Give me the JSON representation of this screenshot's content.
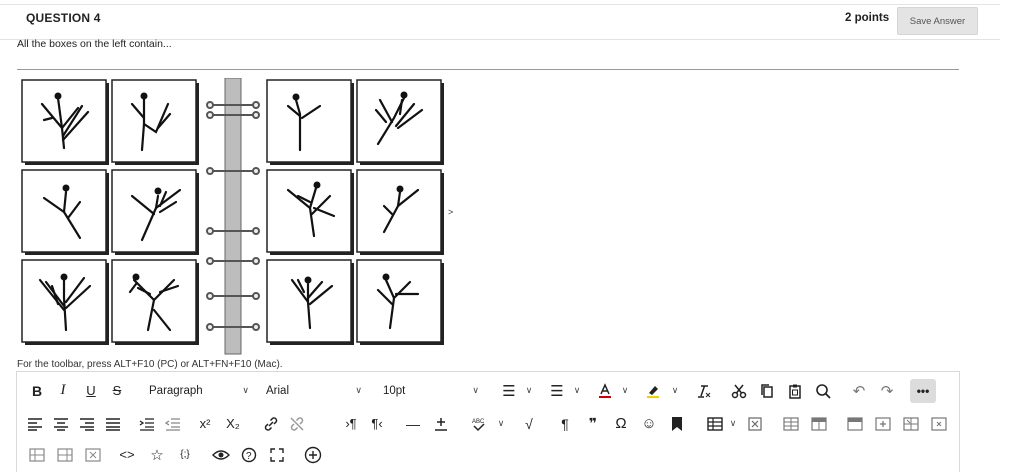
{
  "question": {
    "title": "QUESTION 4",
    "points": "2 points",
    "save_label": "Save Answer",
    "prompt": "All the boxes on the left contain..."
  },
  "nav": {
    "arrow": ">"
  },
  "editor": {
    "hint": "For the toolbar, press ALT+F10 (PC) or ALT+FN+F10 (Mac).",
    "format_select": "Paragraph",
    "font_select": "Arial",
    "size_select": "10pt",
    "buttons": {
      "bold": "B",
      "italic": "I",
      "underline": "U",
      "strike": "S",
      "more": "•••",
      "superscript": "x²",
      "subscript": "X₂",
      "omega": "Ω",
      "pilcrow": "¶",
      "quote": "❞",
      "code": "<>",
      "braces": "{;}",
      "minus": "—"
    }
  }
}
